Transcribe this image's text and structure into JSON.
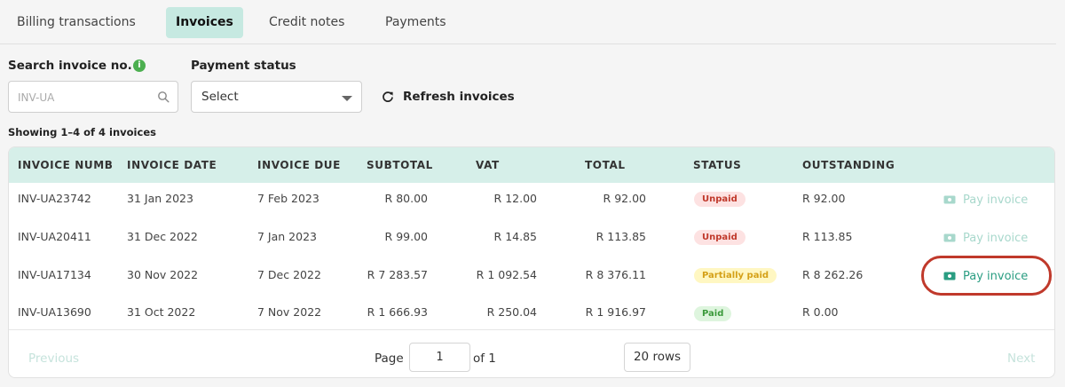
{
  "tabs": [
    {
      "label": "Billing transactions"
    },
    {
      "label": "Invoices"
    },
    {
      "label": "Credit notes"
    },
    {
      "label": "Payments"
    }
  ],
  "filters": {
    "search_label": "Search invoice no.",
    "search_placeholder": "INV-UA",
    "status_label": "Payment status",
    "status_value": "Select",
    "refresh_label": "Refresh invoices"
  },
  "showing_text": "Showing 1–4 of 4 invoices",
  "table": {
    "headers": [
      "INVOICE NUMB",
      "INVOICE DATE",
      "INVOICE DUE",
      "SUBTOTAL",
      "VAT",
      "TOTAL",
      "STATUS",
      "OUTSTANDING"
    ],
    "rows": [
      {
        "number": "INV-UA23742",
        "date": "31 Jan 2023",
        "due": "7 Feb 2023",
        "subtotal": "R 80.00",
        "vat": "R 12.00",
        "total": "R 92.00",
        "status": "Unpaid",
        "outstanding": "R 92.00",
        "action": "Pay invoice"
      },
      {
        "number": "INV-UA20411",
        "date": "31 Dec 2022",
        "due": "7 Jan 2023",
        "subtotal": "R 99.00",
        "vat": "R 14.85",
        "total": "R 113.85",
        "status": "Unpaid",
        "outstanding": "R 113.85",
        "action": "Pay invoice"
      },
      {
        "number": "INV-UA17134",
        "date": "30 Nov 2022",
        "due": "7 Dec 2022",
        "subtotal": "R 7 283.57",
        "vat": "R 1 092.54",
        "total": "R 8 376.11",
        "status": "Partially paid",
        "outstanding": "R 8 262.26",
        "action": "Pay invoice"
      },
      {
        "number": "INV-UA13690",
        "date": "31 Oct 2022",
        "due": "7 Nov 2022",
        "subtotal": "R 1 666.93",
        "vat": "R 250.04",
        "total": "R 1 916.97",
        "status": "Paid",
        "outstanding": "R 0.00",
        "action": ""
      }
    ]
  },
  "pagination": {
    "previous": "Previous",
    "page_label": "Page",
    "page_value": "1",
    "of_label": "of 1",
    "rows_value": "20 rows",
    "next": "Next"
  },
  "colors": {
    "accent": "#c6e9e1",
    "header_bg": "#d6efe9",
    "unpaid_bg": "#fde2e2",
    "unpaid_fg": "#c0392b",
    "partial_bg": "#fff7c2",
    "partial_fg": "#d4a017",
    "paid_bg": "#def5de",
    "paid_fg": "#3c9a3c",
    "highlight": "#c0392b"
  },
  "icons": {
    "info": "info-icon",
    "search": "search-icon",
    "dropdown": "chevron-down-icon",
    "refresh": "refresh-icon",
    "pay": "banknote-icon"
  }
}
